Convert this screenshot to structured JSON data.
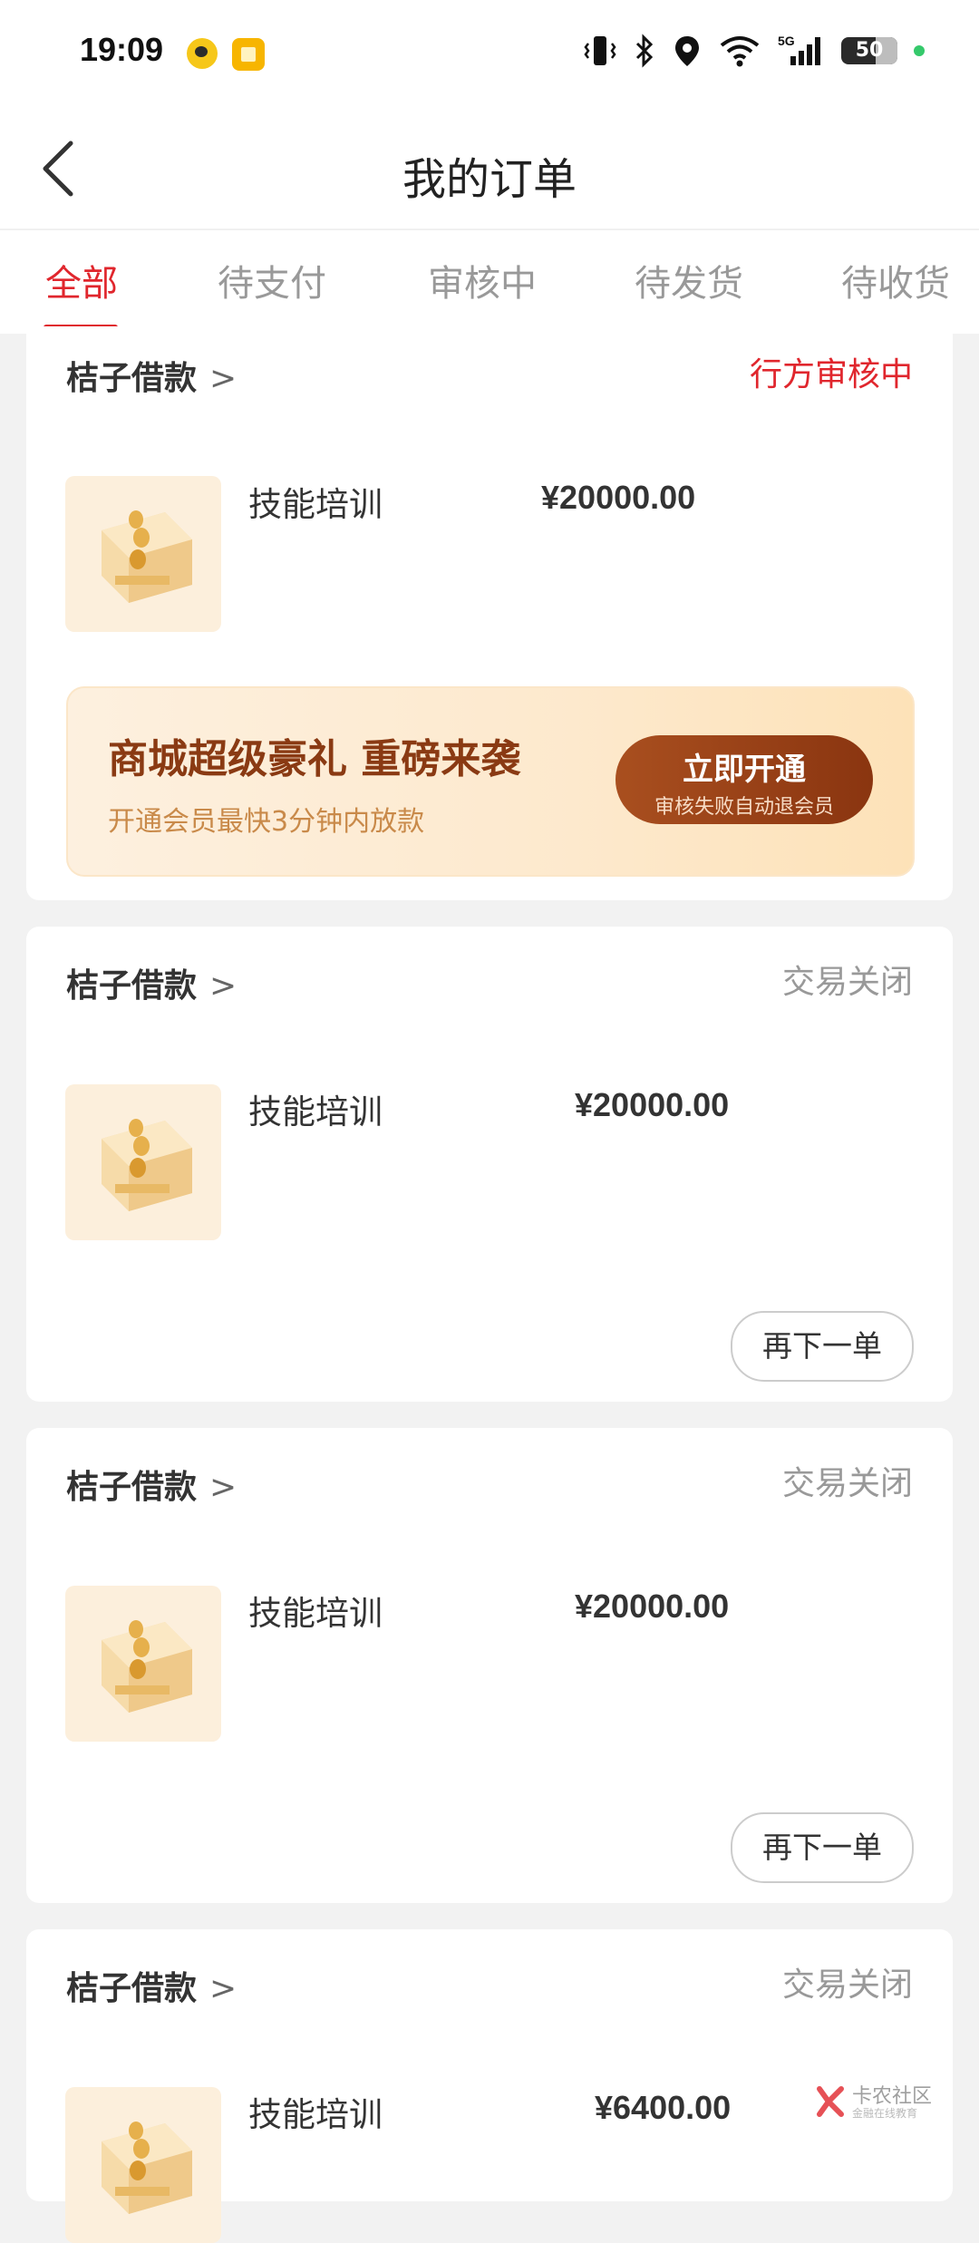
{
  "status_bar": {
    "time": "19:09",
    "battery": "50",
    "network": "5G"
  },
  "header": {
    "title": "我的订单"
  },
  "tabs": [
    {
      "label": "全部",
      "active": true
    },
    {
      "label": "待支付"
    },
    {
      "label": "审核中"
    },
    {
      "label": "待发货"
    },
    {
      "label": "待收货"
    }
  ],
  "orders": [
    {
      "merchant": "桔子借款",
      "status": "行方审核中",
      "product": "技能培训",
      "price": "¥20000.00"
    },
    {
      "merchant": "桔子借款",
      "status": "交易关闭",
      "product": "技能培训",
      "price": "¥20000.00",
      "action": "再下一单"
    },
    {
      "merchant": "桔子借款",
      "status": "交易关闭",
      "product": "技能培训",
      "price": "¥20000.00",
      "action": "再下一单"
    },
    {
      "merchant": "桔子借款",
      "status": "交易关闭",
      "product": "技能培训",
      "price": "¥6400.00"
    }
  ],
  "promo": {
    "title": "商城超级豪礼 重磅来袭",
    "subtitle": "开通会员最快3分钟内放款",
    "button_main": "立即开通",
    "button_sub": "审核失败自动退会员"
  },
  "watermark": {
    "text": "卡农社区",
    "sub": "金融在线教育"
  },
  "colors": {
    "accent": "#e0262d",
    "promo_button": "#8a3510"
  }
}
